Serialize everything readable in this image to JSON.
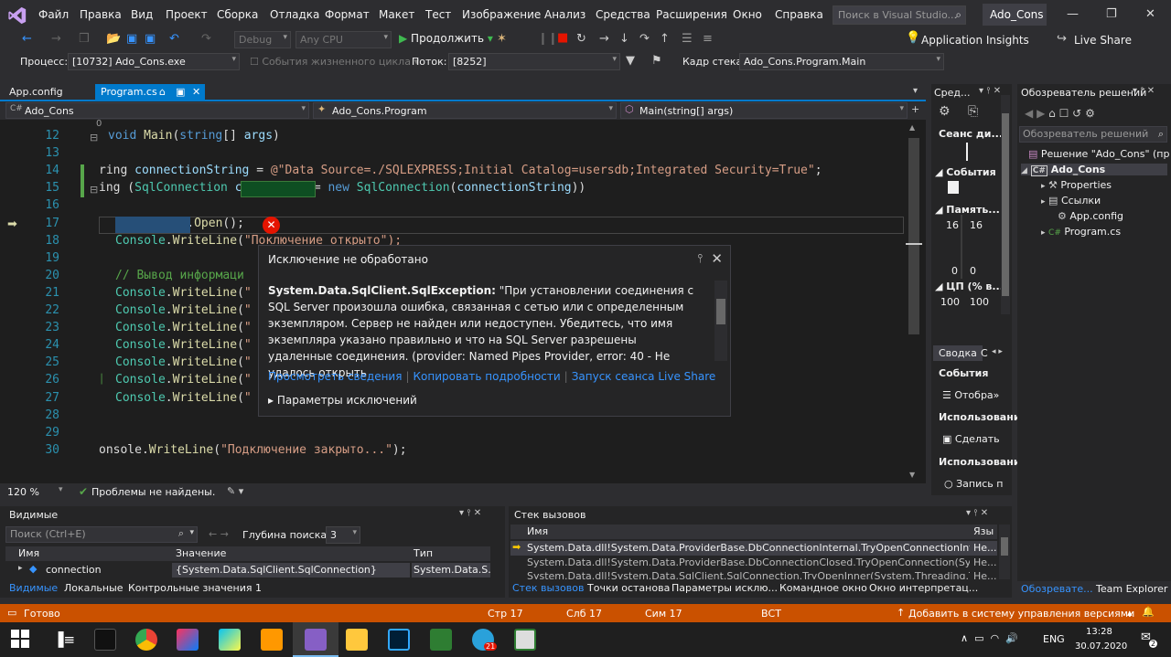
{
  "menu": {
    "items": [
      "Файл",
      "Правка",
      "Вид",
      "Проект",
      "Сборка",
      "Отладка",
      "Формат",
      "Макет",
      "Тест",
      "Изображение",
      "Анализ",
      "Средства",
      "Расширения",
      "Окно",
      "Справка"
    ],
    "search_placeholder": "Поиск в Visual Studio...",
    "solution_name": "Ado_Cons"
  },
  "toolbar": {
    "config": "Debug",
    "platform": "Any CPU",
    "continue_label": "Продолжить",
    "app_insights": "Application Insights",
    "live_share": "Live Share"
  },
  "debugbar": {
    "process_label": "Процесс:",
    "process_value": "[10732] Ado_Cons.exe",
    "lifecycle_label": "События жизненного цикла",
    "thread_label": "Поток:",
    "thread_value": "[8252]",
    "frame_label": "Кадр стека:",
    "frame_value": "Ado_Cons.Program.Main"
  },
  "tabs": [
    {
      "label": "App.config"
    },
    {
      "label": "Program.cs"
    }
  ],
  "nav": {
    "project": "Ado_Cons",
    "class": "Ado_Cons.Program",
    "member": "Main(string[] args)"
  },
  "editor": {
    "ref_count": "0",
    "lines": [
      {
        "n": "12",
        "code": "void Main(string[] args)"
      },
      {
        "n": "13",
        "code": ""
      },
      {
        "n": "14",
        "code": "ring connectionString = @\"Data Source=./SQLEXPRESS;Initial Catalog=usersdb;Integrated Security=True\";"
      },
      {
        "n": "15",
        "code": "ing (SqlConnection connection = new SqlConnection(connectionString))"
      },
      {
        "n": "16",
        "code": ""
      },
      {
        "n": "17",
        "code": "connection.Open();"
      },
      {
        "n": "18",
        "code": "Console.WriteLine(\"По"
      },
      {
        "n": "19",
        "code": ""
      },
      {
        "n": "20",
        "code": "// Вывод информаци"
      },
      {
        "n": "21",
        "code": "Console.WriteLine(\""
      },
      {
        "n": "22",
        "code": "Console.WriteLine(\""
      },
      {
        "n": "23",
        "code": "Console.WriteLine(\""
      },
      {
        "n": "24",
        "code": "Console.WriteLine(\""
      },
      {
        "n": "25",
        "code": "Console.WriteLine(\""
      },
      {
        "n": "26",
        "code": "Console.WriteLine(\""
      },
      {
        "n": "27",
        "code": "Console.WriteLine(\""
      },
      {
        "n": "28",
        "code": ""
      },
      {
        "n": "29",
        "code": ""
      },
      {
        "n": "30",
        "code": "onsole.WriteLine(\"Подключение закрыто...\");"
      }
    ],
    "line18_tail": "ключение открыто\");"
  },
  "exception": {
    "title": "Исключение не обработано",
    "type": "System.Data.SqlClient.SqlException:",
    "message": "\"При установлении соединения с SQL Server произошла ошибка, связанная с сетью или с определенным экземпляром. Сервер не найден или недоступен. Убедитесь, что имя экземпляра указано правильно и что на SQL Server разрешены удаленные соединения. (provider: Named Pipes Provider, error: 40 - Не удалось открыть",
    "link_details": "Просмотреть сведения",
    "link_copy": "Копировать подробности",
    "link_liveshare": "Запуск сеанса Live Share",
    "params": "Параметры исключений"
  },
  "editor_status": {
    "zoom": "120 %",
    "problems": "Проблемы не найдены."
  },
  "diag": {
    "title": "Сред...",
    "session": "Сеанс ди...",
    "events": "События",
    "memory": "Память...",
    "mem_top_left": "16",
    "mem_top_right": "16",
    "mem_bot_left": "0",
    "mem_bot_right": "0",
    "cpu": "ЦП (% в...",
    "cpu_left": "100",
    "cpu_right": "100",
    "tab_summary": "Сводка",
    "tab_events": "С",
    "sec_events": "События",
    "show": "Отобра»",
    "usage1": "Использование",
    "make": "Сделать",
    "usage2": "Использование",
    "record": "Запись п"
  },
  "solution_explorer": {
    "title": "Обозреватель решений",
    "search": "Обозреватель решений",
    "solution": "Решение \"Ado_Cons\" (пр",
    "project": "Ado_Cons",
    "items": [
      "Properties",
      "Ссылки",
      "App.config",
      "Program.cs"
    ],
    "tab_solexp": "Обозревате...",
    "tab_team": "Team Explorer"
  },
  "locals": {
    "title": "Видимые",
    "search": "Поиск (Ctrl+E)",
    "depth_label": "Глубина поиска:",
    "depth_value": "3",
    "col_name": "Имя",
    "col_value": "Значение",
    "col_type": "Тип",
    "rows": [
      {
        "name": "connection",
        "value": "{System.Data.SqlClient.SqlConnection}",
        "type": "System.Data.S..."
      }
    ],
    "tabs": [
      "Видимые",
      "Локальные",
      "Контрольные значения 1"
    ]
  },
  "callstack": {
    "title": "Стек вызовов",
    "col_name": "Имя",
    "col_lang": "Язы",
    "rows": [
      {
        "name": "System.Data.dll!System.Data.ProviderBase.DbConnectionInternal.TryOpenConnectionInternal(Sy...",
        "lang": "Не..."
      },
      {
        "name": "System.Data.dll!System.Data.ProviderBase.DbConnectionClosed.TryOpenConnection(System.Dat...",
        "lang": "Не..."
      },
      {
        "name": "System.Data.dll!System.Data.SqlClient.SqlConnection.TryOpenInner(System.Threading.Tasks.Task...",
        "lang": "Не..."
      }
    ],
    "tabs": [
      "Стек вызовов",
      "Точки останова",
      "Параметры исклю...",
      "Командное окно",
      "Окно интерпретац..."
    ]
  },
  "statusbar": {
    "ready": "Готово",
    "line": "Стр 17",
    "col": "Слб 17",
    "ch": "Сим 17",
    "ins": "ВСТ",
    "vcs": "Добавить в систему управления версиями"
  },
  "taskbar": {
    "lang": "ENG",
    "time": "13:28",
    "date": "30.07.2020",
    "badge_tg": "21",
    "badge_notif": "2"
  },
  "colors": {
    "accent": "#007acc",
    "status": "#ca5100",
    "error": "#e51400"
  }
}
